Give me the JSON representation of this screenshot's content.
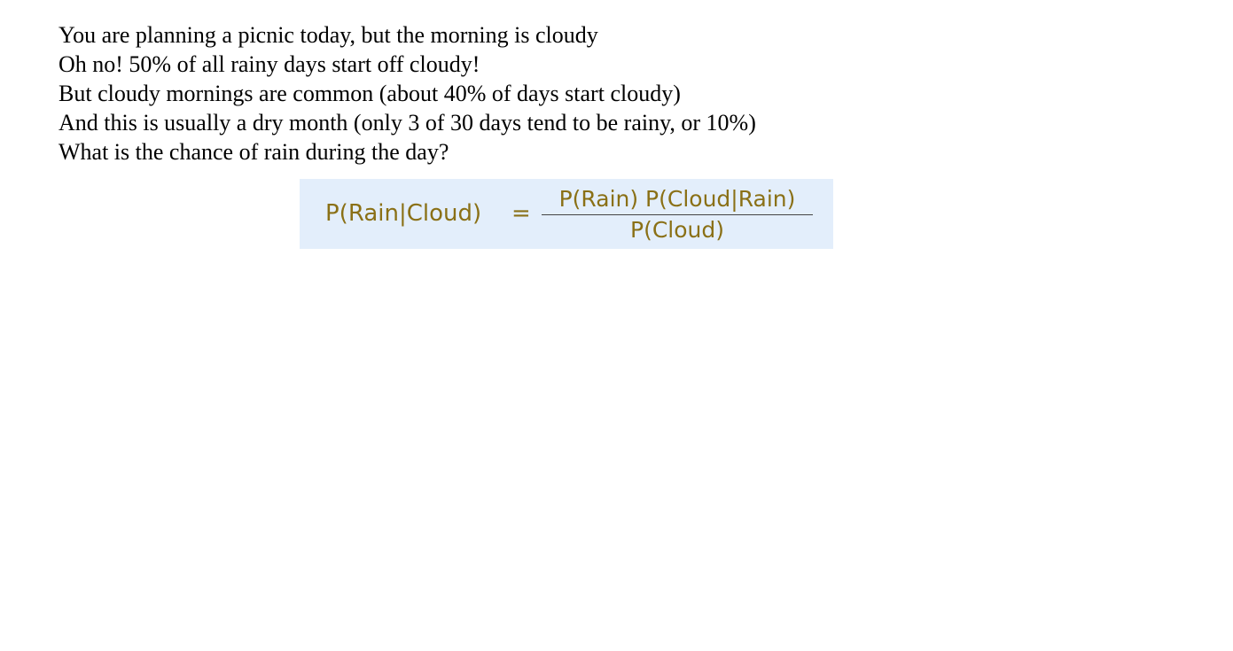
{
  "problem": {
    "lines": [
      "You are planning a picnic today, but the morning is cloudy",
      "Oh no! 50% of all rainy days start off cloudy!",
      "But cloudy mornings are common (about 40% of days start cloudy)",
      "And this is usually a dry month (only 3 of 30 days tend to be rainy, or 10%)",
      "What is the chance of rain during the day?"
    ]
  },
  "formula": {
    "lhs": "P(Rain|Cloud)",
    "equals": "=",
    "numerator": "P(Rain) P(Cloud|Rain)",
    "denominator": "P(Cloud)",
    "box_color": "#e3eefb",
    "text_color": "#8a7016"
  }
}
